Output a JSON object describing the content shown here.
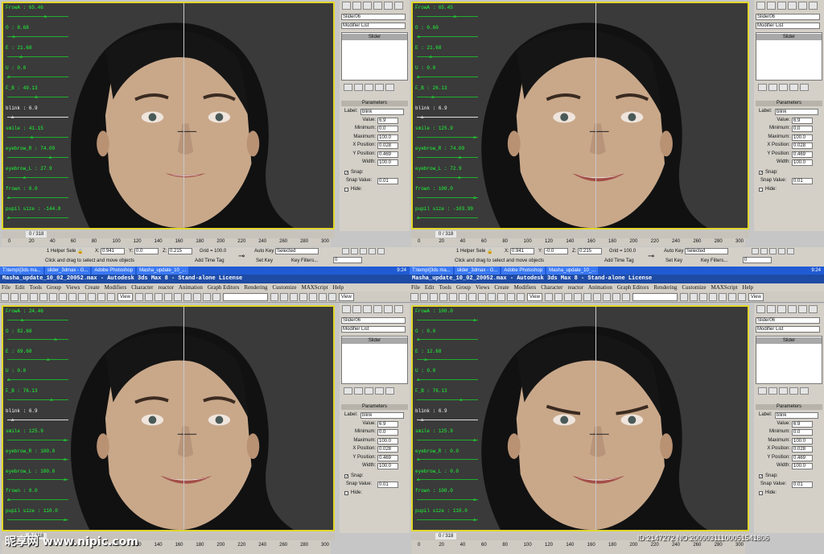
{
  "window_title": "Masha_update_10_02_20052.max - Autodesk 3ds Max 8 - Stand-alone License",
  "menu": [
    "File",
    "Edit",
    "Tools",
    "Group",
    "Views",
    "Create",
    "Modifiers",
    "Character",
    "reactor",
    "Animation",
    "Graph Editors",
    "Rendering",
    "Customize",
    "MAXScript",
    "Help"
  ],
  "toolbar": {
    "view_label": "View",
    "view_label_right": "View"
  },
  "command_panel": {
    "object_name": "Slider06",
    "modifier_list": "Modifier List",
    "stack_item": "Slider",
    "params_rollout": "Parameters",
    "label_caption": "Label:",
    "label_value": "blink",
    "value_caption": "Value:",
    "min_caption": "Minimum:",
    "max_caption": "Maximum:",
    "xpos_caption": "X Position:",
    "ypos_caption": "Y Position:",
    "width_caption": "Width:",
    "snap_caption": "Snap:",
    "snap_value_caption": "Snap Value:",
    "hide_caption": "Hide:",
    "minimum": "0.0",
    "maximum": "100.0",
    "x_position": "0.028",
    "y_position": "0.469",
    "width": "100.0",
    "snap_value": "0.01"
  },
  "status": {
    "helper": "1 Helper Sele",
    "x_label": "X:",
    "x_value": "0.941",
    "y_label": "Y:",
    "y_value_a": "0.0",
    "y_value_b": "-0.0",
    "z_label": "Z:",
    "z_value": "0.215",
    "grid": "Grid = 100.0",
    "prompt": "Click and drag to select and move objects",
    "add_time_tag": "Add Time Tag",
    "auto_key": "Auto Key",
    "set_key": "Set Key",
    "selected": "Selected",
    "key_filters": "Key Filters...",
    "frame_field": "0",
    "frame_counter": "0 / 318"
  },
  "timeline_ticks": [
    "0",
    "20",
    "40",
    "60",
    "80",
    "100",
    "120",
    "140",
    "160",
    "180",
    "200",
    "220",
    "240",
    "260",
    "280",
    "300"
  ],
  "taskbar": {
    "tasks": [
      "T:\\temp\\[3ds ma...",
      "slider_3dmax - G...",
      "Adobe Photoshop",
      "Masha_update_10_..."
    ],
    "clock": "9:24"
  },
  "panels": [
    {
      "value": "6.9",
      "sliders": [
        {
          "name": "FrowA",
          "value": "65.46",
          "frac": 0.65,
          "white": false
        },
        {
          "name": "O",
          "value": "8.68",
          "frac": 0.09,
          "white": false
        },
        {
          "name": "E",
          "value": "21.68",
          "frac": 0.22,
          "white": false
        },
        {
          "name": "U",
          "value": "0.0",
          "frac": 0.0,
          "white": false
        },
        {
          "name": "F_B",
          "value": "49.13",
          "frac": 0.49,
          "white": false
        },
        {
          "name": "blink",
          "value": "6.9",
          "frac": 0.07,
          "white": true
        },
        {
          "name": "smile",
          "value": "41.15",
          "frac": 0.41,
          "white": false
        },
        {
          "name": "eyebrow_R",
          "value": "74.09",
          "frac": 0.74,
          "white": false
        },
        {
          "name": "eyebrow_L",
          "value": "27.9",
          "frac": 0.28,
          "white": false
        },
        {
          "name": "frown",
          "value": "0.0",
          "frac": 0.0,
          "white": false
        },
        {
          "name": "pupil size",
          "value": "-144.8",
          "frac": 0.0,
          "white": false
        }
      ]
    },
    {
      "value": "6.9",
      "sliders": [
        {
          "name": "FrowA",
          "value": "65.45",
          "frac": 0.65,
          "white": false
        },
        {
          "name": "O",
          "value": "0.60",
          "frac": 0.01,
          "white": false
        },
        {
          "name": "E",
          "value": "21.68",
          "frac": 0.22,
          "white": false
        },
        {
          "name": "U",
          "value": "0.0",
          "frac": 0.0,
          "white": false
        },
        {
          "name": "F_B",
          "value": "26.13",
          "frac": 0.26,
          "white": false
        },
        {
          "name": "blink",
          "value": "6.9",
          "frac": 0.07,
          "white": true
        },
        {
          "name": "smile",
          "value": "125.9",
          "frac": 1.0,
          "white": false
        },
        {
          "name": "eyebrow_R",
          "value": "74.09",
          "frac": 0.74,
          "white": false
        },
        {
          "name": "eyebrow_L",
          "value": "72.9",
          "frac": 0.73,
          "white": false
        },
        {
          "name": "frown",
          "value": "100.0",
          "frac": 1.0,
          "white": false
        },
        {
          "name": "pupil size",
          "value": "-103.99",
          "frac": 0.0,
          "white": false
        }
      ]
    },
    {
      "value": "6.9",
      "sliders": [
        {
          "name": "FrowA",
          "value": "24.46",
          "frac": 0.24,
          "white": false
        },
        {
          "name": "O",
          "value": "82.68",
          "frac": 0.83,
          "white": false
        },
        {
          "name": "E",
          "value": "69.68",
          "frac": 0.7,
          "white": false
        },
        {
          "name": "U",
          "value": "0.0",
          "frac": 0.0,
          "white": false
        },
        {
          "name": "F_B",
          "value": "76.13",
          "frac": 0.76,
          "white": false
        },
        {
          "name": "blink",
          "value": "6.9",
          "frac": 0.07,
          "white": true
        },
        {
          "name": "smile",
          "value": "125.9",
          "frac": 1.0,
          "white": false
        },
        {
          "name": "eyebrow_R",
          "value": "100.0",
          "frac": 1.0,
          "white": false
        },
        {
          "name": "eyebrow_L",
          "value": "100.0",
          "frac": 1.0,
          "white": false
        },
        {
          "name": "frown",
          "value": "0.0",
          "frac": 0.0,
          "white": false
        },
        {
          "name": "pupil size",
          "value": "110.0",
          "frac": 1.0,
          "white": false
        }
      ]
    },
    {
      "value": "6.9",
      "sliders": [
        {
          "name": "FrowA",
          "value": "100.0",
          "frac": 1.0,
          "white": false
        },
        {
          "name": "O",
          "value": "0.0",
          "frac": 0.0,
          "white": false
        },
        {
          "name": "E",
          "value": "12.68",
          "frac": 0.13,
          "white": false
        },
        {
          "name": "U",
          "value": "0.0",
          "frac": 0.0,
          "white": false
        },
        {
          "name": "F_B",
          "value": "76.13",
          "frac": 0.76,
          "white": false
        },
        {
          "name": "blink",
          "value": "6.9",
          "frac": 0.07,
          "white": true
        },
        {
          "name": "smile",
          "value": "125.9",
          "frac": 1.0,
          "white": false
        },
        {
          "name": "eyebrow_R",
          "value": "0.0",
          "frac": 0.0,
          "white": false
        },
        {
          "name": "eyebrow_L",
          "value": "0.0",
          "frac": 0.0,
          "white": false
        },
        {
          "name": "frown",
          "value": "100.0",
          "frac": 1.0,
          "white": false
        },
        {
          "name": "pupil size",
          "value": "110.0",
          "frac": 1.0,
          "white": false
        }
      ]
    }
  ],
  "watermark": {
    "logo": "昵享网 www.nipic.com",
    "id_text": "ID:2147272 NO:20090311100051541806"
  },
  "colors": {
    "viewport_bg": "#3a3a3a",
    "viewport_border": "#e1d629",
    "ui_green": "#1cff35",
    "title_blue": "#1e4ba4"
  }
}
